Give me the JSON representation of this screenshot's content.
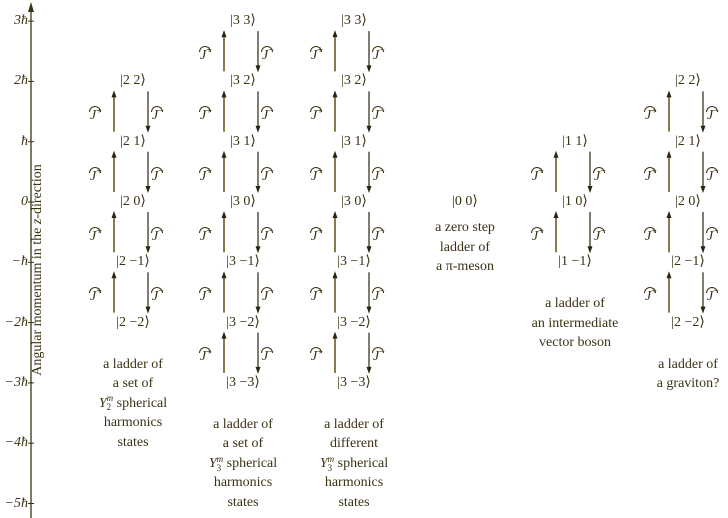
{
  "axis": {
    "title": "Angular momentum in the z-direction",
    "title_prefix": "Angular momentum in the ",
    "title_var": "z",
    "title_suffix": "-direction",
    "ticks": [
      {
        "value": 3,
        "label": "3ħ"
      },
      {
        "value": 2,
        "label": "2ħ"
      },
      {
        "value": 1,
        "label": "ħ"
      },
      {
        "value": 0,
        "label": "0"
      },
      {
        "value": -1,
        "label": "−ħ"
      },
      {
        "value": -2,
        "label": "−2ħ"
      },
      {
        "value": -3,
        "label": "−3ħ"
      },
      {
        "value": -4,
        "label": "−4ħ"
      },
      {
        "value": -5,
        "label": "−5ħ"
      }
    ],
    "range": [
      -5,
      3
    ]
  },
  "operators": {
    "raise": {
      "symbol": "J",
      "superscript": "+",
      "label": "Ĵ+"
    },
    "lower": {
      "symbol": "J",
      "superscript": "−",
      "label": "Ĵ−"
    }
  },
  "ladders": [
    {
      "id": "y2-spherical-harmonics",
      "l": 2,
      "states": [
        {
          "l": 2,
          "m": 2,
          "label": "|2  2⟩"
        },
        {
          "l": 2,
          "m": 1,
          "label": "|2  1⟩"
        },
        {
          "l": 2,
          "m": 0,
          "label": "|2  0⟩"
        },
        {
          "l": 2,
          "m": -1,
          "label": "|2 −1⟩"
        },
        {
          "l": 2,
          "m": -2,
          "label": "|2 −2⟩"
        }
      ],
      "caption_lines": [
        "a ladder of",
        "a set of",
        "Y₂ᵐ spherical",
        "harmonics",
        "states"
      ],
      "caption_symbol": {
        "base": "Y",
        "sub": "2",
        "sup": "m",
        "after": " spherical"
      }
    },
    {
      "id": "y3-spherical-harmonics-set",
      "l": 3,
      "states": [
        {
          "l": 3,
          "m": 3,
          "label": "|3  3⟩"
        },
        {
          "l": 3,
          "m": 2,
          "label": "|3  2⟩"
        },
        {
          "l": 3,
          "m": 1,
          "label": "|3  1⟩"
        },
        {
          "l": 3,
          "m": 0,
          "label": "|3  0⟩"
        },
        {
          "l": 3,
          "m": -1,
          "label": "|3 −1⟩"
        },
        {
          "l": 3,
          "m": -2,
          "label": "|3 −2⟩"
        },
        {
          "l": 3,
          "m": -3,
          "label": "|3 −3⟩"
        }
      ],
      "caption_lines": [
        "a ladder of",
        "a set of",
        "Y₃ᵐ spherical",
        "harmonics",
        "states"
      ],
      "caption_symbol": {
        "base": "Y",
        "sub": "3",
        "sup": "m",
        "after": " spherical"
      }
    },
    {
      "id": "y3-spherical-harmonics-different",
      "l": 3,
      "states": [
        {
          "l": 3,
          "m": 3,
          "label": "|3  3⟩"
        },
        {
          "l": 3,
          "m": 2,
          "label": "|3  2⟩"
        },
        {
          "l": 3,
          "m": 1,
          "label": "|3  1⟩"
        },
        {
          "l": 3,
          "m": 0,
          "label": "|3  0⟩"
        },
        {
          "l": 3,
          "m": -1,
          "label": "|3 −1⟩"
        },
        {
          "l": 3,
          "m": -2,
          "label": "|3 −2⟩"
        },
        {
          "l": 3,
          "m": -3,
          "label": "|3 −3⟩"
        }
      ],
      "caption_lines": [
        "a ladder of",
        "different",
        "Y₃ᵐ spherical",
        "harmonics",
        "states"
      ],
      "caption_symbol": {
        "base": "Y",
        "sub": "3",
        "sup": "m",
        "after": " spherical"
      }
    },
    {
      "id": "pi-meson",
      "l": 0,
      "states": [
        {
          "l": 0,
          "m": 0,
          "label": "|0  0⟩"
        }
      ],
      "caption_lines": [
        "a zero step",
        "ladder of",
        "a π-meson"
      ]
    },
    {
      "id": "intermediate-vector-boson",
      "l": 1,
      "states": [
        {
          "l": 1,
          "m": 1,
          "label": "|1  1⟩"
        },
        {
          "l": 1,
          "m": 0,
          "label": "|1  0⟩"
        },
        {
          "l": 1,
          "m": -1,
          "label": "|1 −1⟩"
        }
      ],
      "caption_lines": [
        "a ladder of",
        "an intermediate",
        "vector boson"
      ]
    },
    {
      "id": "graviton",
      "l": 2,
      "states": [
        {
          "l": 2,
          "m": 2,
          "label": "|2  2⟩"
        },
        {
          "l": 2,
          "m": 1,
          "label": "|2  1⟩"
        },
        {
          "l": 2,
          "m": 0,
          "label": "|2  0⟩"
        },
        {
          "l": 2,
          "m": -1,
          "label": "|2 −1⟩"
        },
        {
          "l": 2,
          "m": -2,
          "label": "|2 −2⟩"
        }
      ],
      "caption_lines": [
        "a ladder of",
        "a graviton?"
      ]
    }
  ],
  "colors": {
    "text": "#3b3214",
    "raise_arrow": "#8a7a52",
    "lower_arrow": "#2a2410",
    "axis": "#3b3214"
  }
}
